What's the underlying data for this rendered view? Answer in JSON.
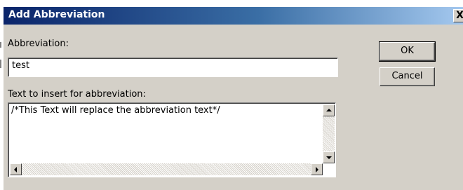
{
  "dialog": {
    "title": "Add Abbreviation",
    "close_glyph": "X"
  },
  "form": {
    "abbreviation_label": "Abbreviation:",
    "abbreviation_value": "test",
    "insert_text_label": "Text to insert for abbreviation:",
    "insert_text_value": "/*This Text will replace the abbreviation text*/"
  },
  "buttons": {
    "ok_label": "OK",
    "cancel_label": "Cancel"
  },
  "icons": {
    "close": "close-icon",
    "scroll_up": "arrow-up-icon",
    "scroll_down": "arrow-down-icon",
    "scroll_left": "arrow-left-icon",
    "scroll_right": "arrow-right-icon"
  },
  "colors": {
    "titlebar_start": "#0a246a",
    "titlebar_end": "#a6caf0",
    "dialog_face": "#d4d0c8"
  }
}
